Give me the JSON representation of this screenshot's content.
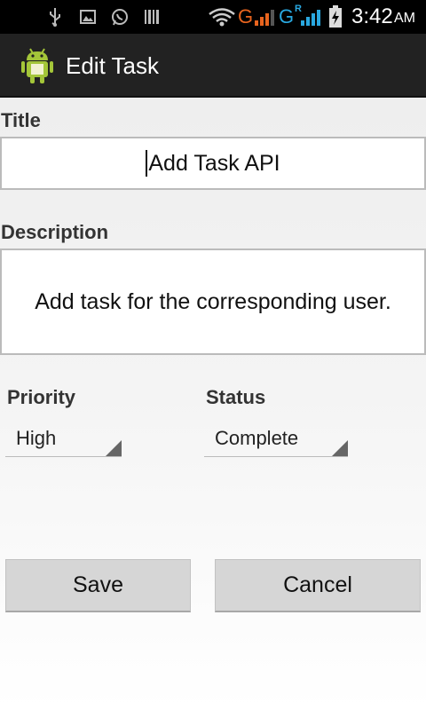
{
  "status_bar": {
    "network_letter_1": "G",
    "network_letter_2": "G",
    "roaming": "R",
    "time": "3:42",
    "ampm": "AM"
  },
  "action_bar": {
    "title": "Edit Task",
    "icon": "android-icon"
  },
  "form": {
    "title_label": "Title",
    "title_value": "Add Task API",
    "description_label": "Description",
    "description_value": "Add task for the corresponding user.",
    "priority_label": "Priority",
    "priority_value": "High",
    "status_label": "Status",
    "status_value": "Complete"
  },
  "buttons": {
    "save_label": "Save",
    "cancel_label": "Cancel"
  },
  "colors": {
    "network_g1": "#e8641e",
    "network_g2": "#29a8e0",
    "signal_bars_1": "#e8641e",
    "signal_bars_2": "#29a8e0",
    "action_bar_bg": "#222222",
    "android_green": "#a4c639"
  }
}
